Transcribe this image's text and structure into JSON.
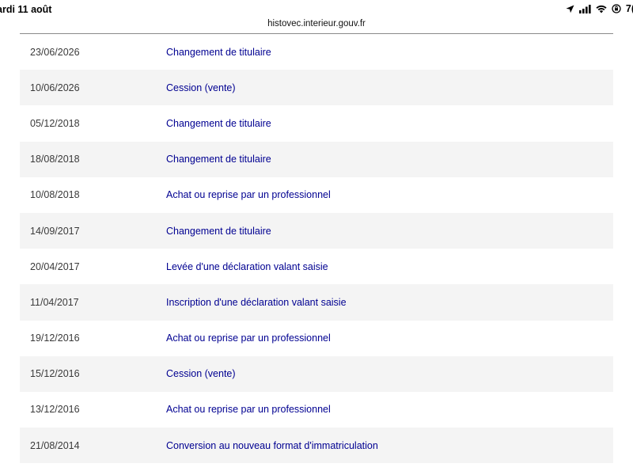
{
  "status_bar": {
    "time": "ardi 11 août",
    "battery": "7("
  },
  "browser": {
    "url": "histovec.interieur.gouv.fr"
  },
  "history": [
    {
      "date": "23/06/2026",
      "event": "Changement de titulaire"
    },
    {
      "date": "10/06/2026",
      "event": "Cession (vente)"
    },
    {
      "date": "05/12/2018",
      "event": "Changement de titulaire"
    },
    {
      "date": "18/08/2018",
      "event": "Changement de titulaire"
    },
    {
      "date": "10/08/2018",
      "event": "Achat ou reprise par un professionnel"
    },
    {
      "date": "14/09/2017",
      "event": "Changement de titulaire"
    },
    {
      "date": "20/04/2017",
      "event": "Levée d'une déclaration valant saisie"
    },
    {
      "date": "11/04/2017",
      "event": "Inscription d'une déclaration valant saisie"
    },
    {
      "date": "19/12/2016",
      "event": "Achat ou reprise par un professionnel"
    },
    {
      "date": "15/12/2016",
      "event": "Cession (vente)"
    },
    {
      "date": "13/12/2016",
      "event": "Achat ou reprise par un professionnel"
    },
    {
      "date": "21/08/2014",
      "event": "Conversion au nouveau format d'immatriculation"
    }
  ],
  "colors": {
    "link": "#000091",
    "row_alt": "#f4f4f4",
    "date_text": "#3a3a3a"
  },
  "icons": [
    "location-arrow-icon",
    "cellular-signal-icon",
    "wifi-icon",
    "orientation-lock-icon"
  ]
}
